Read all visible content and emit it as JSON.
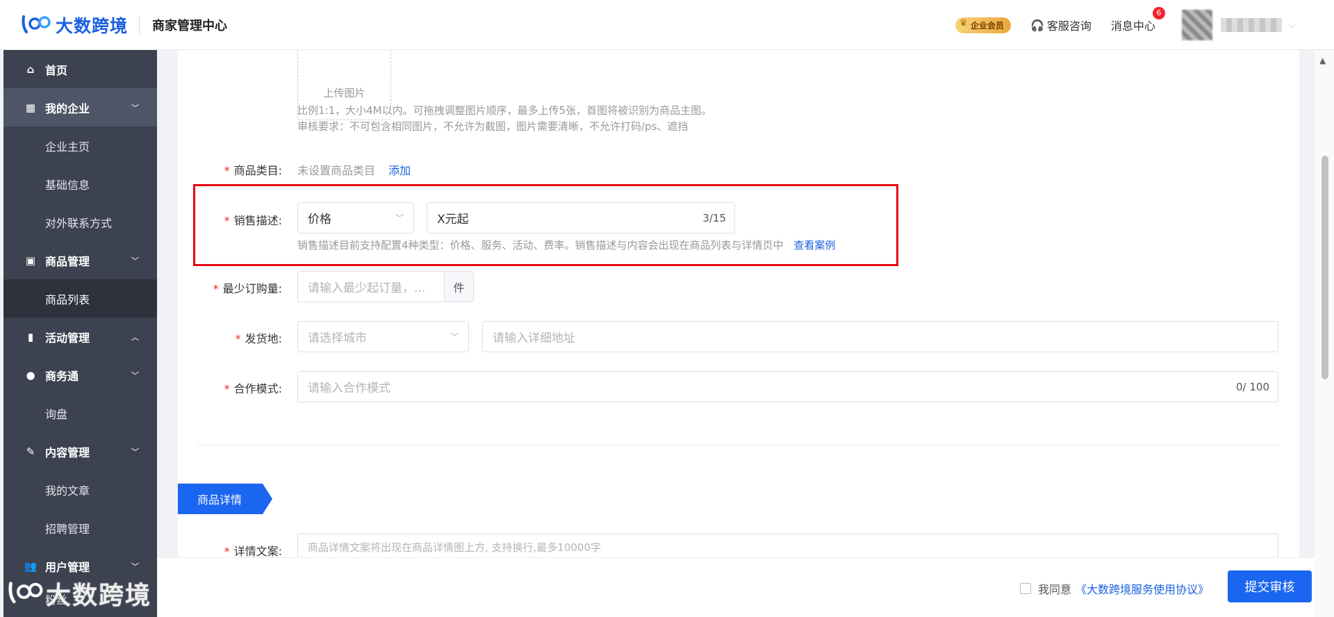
{
  "header": {
    "logo_text": "大数跨境",
    "app_title": "商家管理中心",
    "vip_badge": "企业会员",
    "service_label": "客服咨询",
    "message_label": "消息中心",
    "message_count": "6"
  },
  "sidebar": {
    "home": "首页",
    "my_company": "我的企业",
    "company_home": "企业主页",
    "basic_info": "基础信息",
    "contact": "对外联系方式",
    "product_mgmt": "商品管理",
    "product_list": "商品列表",
    "activity_mgmt": "活动管理",
    "business": "商务通",
    "inquiry": "询盘",
    "content_mgmt": "内容管理",
    "my_articles": "我的文章",
    "recruit": "招聘管理",
    "user_mgmt": "用户管理",
    "fans": "粉丝",
    "watermark": "大数跨境"
  },
  "form": {
    "upload_label": "上传图片",
    "upload_hint1": "比例1:1，大小4M以内。可拖拽调整图片顺序，最多上传5张，首图将被识别为商品主图。",
    "upload_hint2": "审核要求：不可包含相同图片，不允许为截图，图片需要清晰，不允许打码/ps、遮挡",
    "category_label": "商品类目:",
    "category_value": "未设置商品类目",
    "category_add": "添加",
    "sales_label": "销售描述:",
    "sales_type": "价格",
    "sales_value": "X元起",
    "sales_count": "3/15",
    "sales_hint": "销售描述目前支持配置4种类型：价格、服务、活动、费率。销售描述与内容会出现在商品列表与详情页中",
    "sales_example": "查看案例",
    "min_order_label": "最少订购量:",
    "min_order_placeholder": "请输入最少起订量，...",
    "min_order_unit": "件",
    "ship_label": "发货地:",
    "city_placeholder": "请选择城市",
    "address_placeholder": "请输入详细地址",
    "coop_label": "合作模式:",
    "coop_placeholder": "请输入合作模式",
    "coop_count": "0/ 100",
    "section_detail": "商品详情",
    "detail_label": "详情文案:",
    "detail_placeholder": "商品详情文案将出现在商品详情图上方, 支持换行,最多10000字"
  },
  "footer": {
    "agree_text": "我同意",
    "agreement_link": "《大数跨境服务使用协议》",
    "submit": "提交审核"
  },
  "colors": {
    "primary": "#1b66f0",
    "sidebar_bg": "#3c4250",
    "highlight_border": "#e60012"
  }
}
